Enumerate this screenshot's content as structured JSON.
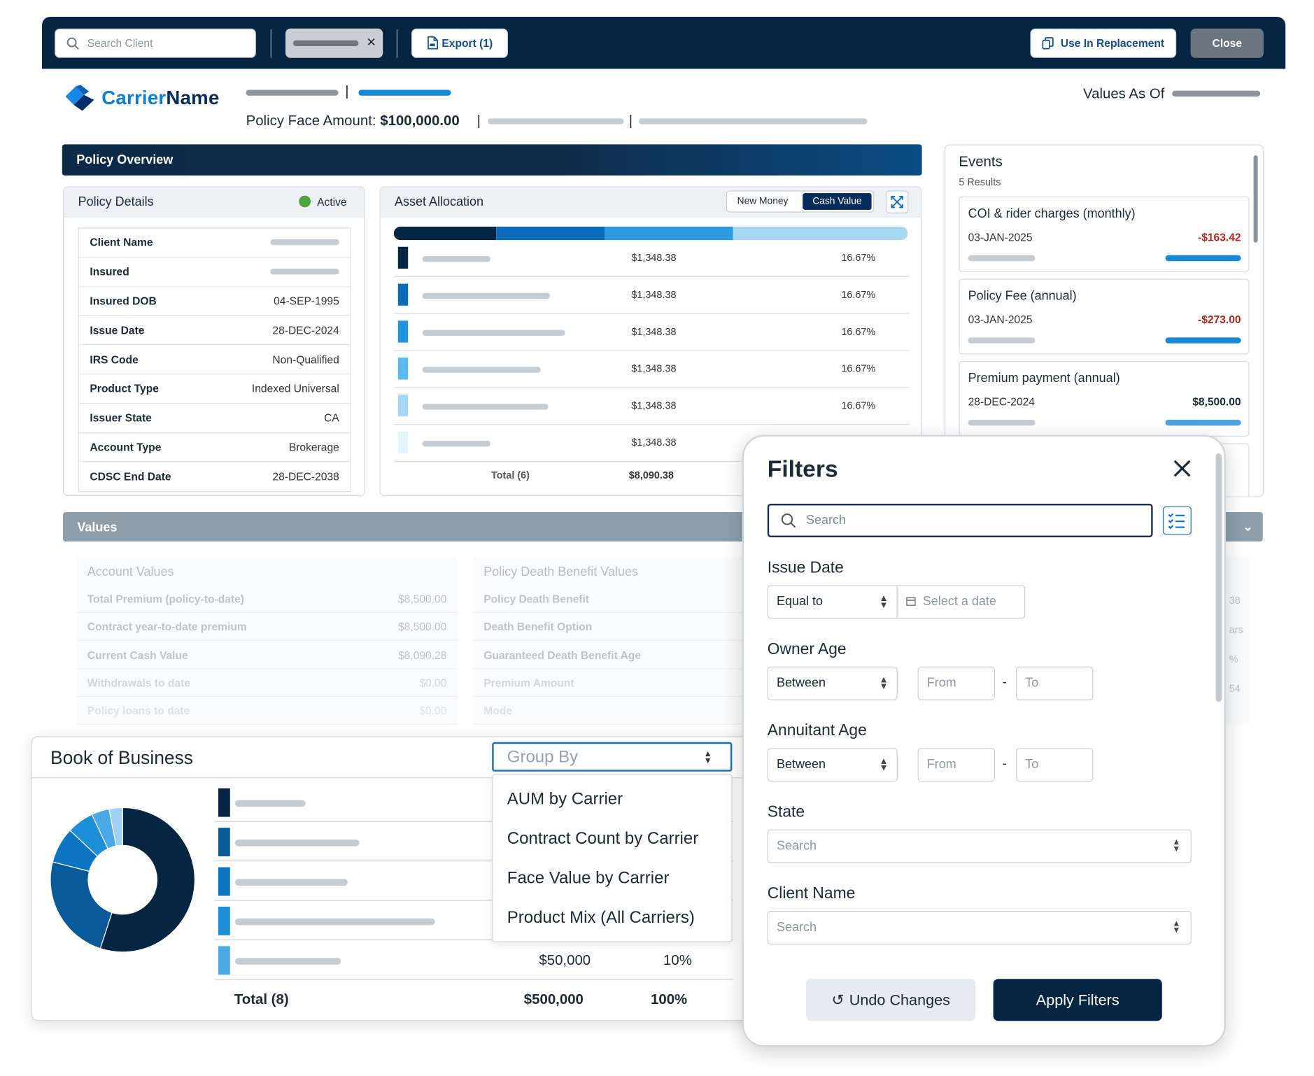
{
  "topbar": {
    "search_placeholder": "Search Client",
    "chip_close": "✕",
    "export_label": "Export (1)",
    "replace_label": "Use In Replacement",
    "close_label": "Close"
  },
  "header": {
    "logo_part1": "Carrier",
    "logo_part2": "Name",
    "sep": "|",
    "face_label": "Policy Face Amount:",
    "face_value": "$100,000.00",
    "values_as_of": "Values As Of"
  },
  "policy_overview": {
    "title": "Policy Overview",
    "details": {
      "title": "Policy Details",
      "status": "Active",
      "rows": [
        {
          "k": "Client Name",
          "v": ""
        },
        {
          "k": "Insured",
          "v": ""
        },
        {
          "k": "Insured DOB",
          "v": "04-SEP-1995"
        },
        {
          "k": "Issue Date",
          "v": "28-DEC-2024"
        },
        {
          "k": "IRS Code",
          "v": "Non-Qualified"
        },
        {
          "k": "Product Type",
          "v": "Indexed Universal"
        },
        {
          "k": "Issuer State",
          "v": "CA"
        },
        {
          "k": "Account Type",
          "v": "Brokerage"
        },
        {
          "k": "CDSC End Date",
          "v": "28-DEC-2038"
        }
      ]
    },
    "allocation": {
      "title": "Asset Allocation",
      "toggle_new": "New Money",
      "toggle_cash": "Cash Value",
      "rows": [
        {
          "amount": "$1,348.38",
          "pct": "16.67%"
        },
        {
          "amount": "$1,348.38",
          "pct": "16.67%"
        },
        {
          "amount": "$1,348.38",
          "pct": "16.67%"
        },
        {
          "amount": "$1,348.38",
          "pct": "16.67%"
        },
        {
          "amount": "$1,348.38",
          "pct": "16.67%"
        },
        {
          "amount": "$1,348.38",
          "pct": ""
        }
      ],
      "total_label": "Total (6)",
      "total_value": "$8,090.38"
    }
  },
  "events": {
    "title": "Events",
    "count": "5 Results",
    "items": [
      {
        "title": "COI & rider charges (monthly)",
        "date": "03-JAN-2025",
        "amount": "-$163.42"
      },
      {
        "title": "Policy Fee (annual)",
        "date": "03-JAN-2025",
        "amount": "-$273.00"
      },
      {
        "title": "Premium payment (annual)",
        "date": "28-DEC-2024",
        "amount": "$8,500.00"
      }
    ],
    "colors": {
      "negative": "#b3261e",
      "positive": "#1b2a38"
    }
  },
  "values": {
    "title": "Values",
    "account": {
      "title": "Account Values",
      "rows": [
        {
          "k": "Total Premium (policy-to-date)",
          "v": "$8,500.00"
        },
        {
          "k": "Contract year-to-date premium",
          "v": "$8,500.00"
        },
        {
          "k": "Current Cash Value",
          "v": "$8,090.28"
        },
        {
          "k": "Withdrawals to date",
          "v": "$0.00"
        },
        {
          "k": "Policy loans to date",
          "v": "$0.00"
        }
      ]
    },
    "death_benefit": {
      "title": "Policy Death Benefit Values",
      "rows": [
        {
          "k": "Policy Death Benefit"
        },
        {
          "k": "Death Benefit Option"
        },
        {
          "k": "Guaranteed Death Benefit Age"
        },
        {
          "k": "Premium Amount"
        },
        {
          "k": "Mode"
        }
      ]
    },
    "right_fragments": [
      "38",
      "ars",
      "%",
      "54"
    ]
  },
  "book_of_business": {
    "title": "Book of Business",
    "group_by_placeholder": "Group By",
    "menu": [
      "AUM by Carrier",
      "Contract Count by Carrier",
      "Face Value by Carrier",
      "Product Mix (All Carriers)"
    ],
    "last_row": {
      "amount": "$50,000",
      "pct": "10%"
    },
    "total_label": "Total (8)",
    "total_amount": "$500,000",
    "total_pct": "100%",
    "donut": [
      {
        "value": 55,
        "color": "#062542"
      },
      {
        "value": 24,
        "color": "#0a5a9a"
      },
      {
        "value": 8,
        "color": "#0d74c4"
      },
      {
        "value": 6,
        "color": "#1e8ed9"
      },
      {
        "value": 4,
        "color": "#4aa8e6"
      },
      {
        "value": 3,
        "color": "#9fd1f2"
      }
    ]
  },
  "filters": {
    "title": "Filters",
    "search_placeholder": "Search",
    "issue_date": {
      "label": "Issue Date",
      "op": "Equal to",
      "placeholder": "Select a date"
    },
    "owner_age": {
      "label": "Owner Age",
      "op": "Between",
      "from": "From",
      "to": "To"
    },
    "annuitant_age": {
      "label": "Annuitant Age",
      "op": "Between",
      "from": "From",
      "to": "To"
    },
    "range_dash": "-",
    "state": {
      "label": "State",
      "placeholder": "Search"
    },
    "client_name": {
      "label": "Client Name",
      "placeholder": "Search"
    },
    "undo_label": "Undo Changes",
    "apply_label": "Apply Filters"
  }
}
